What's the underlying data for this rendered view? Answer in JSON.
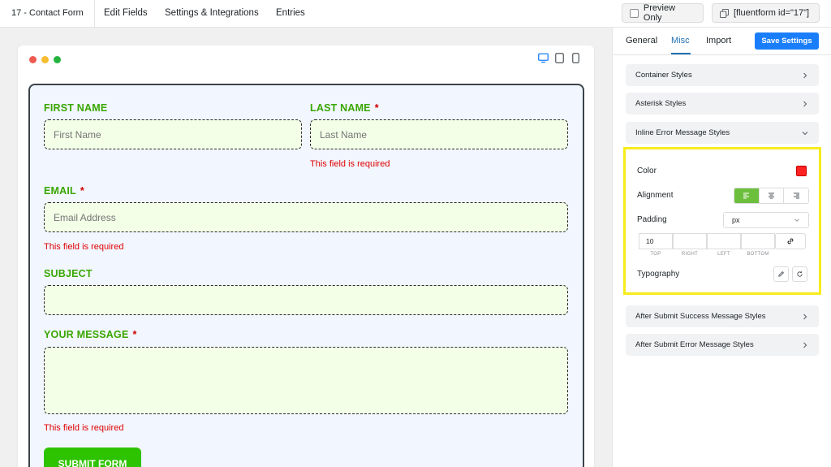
{
  "topbar": {
    "form_title": "17 - Contact Form",
    "nav": [
      "Edit Fields",
      "Settings & Integrations",
      "Entries"
    ],
    "preview_only": "Preview Only",
    "shortcode": "[fluentform id=\"17\"]"
  },
  "form": {
    "first_name_label": "FIRST NAME",
    "first_name_placeholder": "First Name",
    "last_name_label": "LAST NAME",
    "last_name_placeholder": "Last Name",
    "last_name_error": "This field is required",
    "email_label": "EMAIL",
    "email_placeholder": "Email Address",
    "email_error": "This field is required",
    "subject_label": "SUBJECT",
    "message_label": "YOUR MESSAGE",
    "message_error": "This field is required",
    "required_mark": "*",
    "submit_label": "SUBMIT FORM"
  },
  "panel": {
    "tabs": [
      "General",
      "Misc",
      "Import"
    ],
    "active_tab": "Misc",
    "save_label": "Save Settings",
    "sections": [
      "Container Styles",
      "Asterisk Styles",
      "Inline Error Message Styles",
      "After Submit Success Message Styles",
      "After Submit Error Message Styles"
    ],
    "inline_error": {
      "color_label": "Color",
      "color_value": "#ff2222",
      "alignment_label": "Alignment",
      "alignment_active": "left",
      "padding_label": "Padding",
      "padding_unit": "px",
      "padding_values": [
        "10",
        "",
        "",
        ""
      ],
      "padding_captions": [
        "TOP",
        "RIGHT",
        "LEFT",
        "BOTTOM"
      ],
      "typography_label": "Typography"
    }
  },
  "colors": {
    "label_green": "#3aa700",
    "error_red": "#e00000",
    "primary_blue": "#1a7efb",
    "highlight_yellow": "#f7ec1a"
  }
}
